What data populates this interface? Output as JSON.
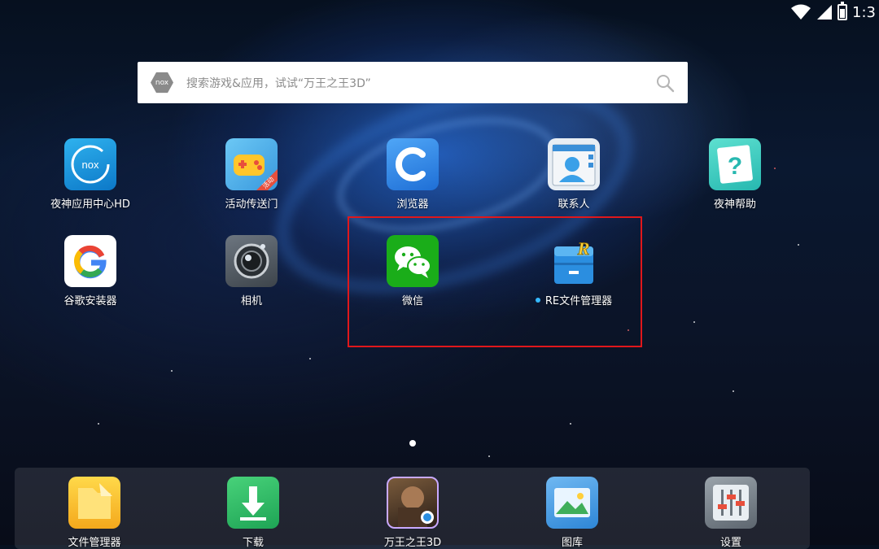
{
  "status_bar": {
    "time": "1:3",
    "icons": [
      "wifi-icon",
      "signal-icon",
      "battery-icon"
    ]
  },
  "search": {
    "placeholder": "搜索游戏&应用，试试“万王之王3D”",
    "logo_text": "nox"
  },
  "apps": [
    {
      "label": "夜神应用中心HD",
      "icon": "nox-app-center-icon"
    },
    {
      "label": "活动传送门",
      "icon": "event-portal-icon",
      "badge": "活动"
    },
    {
      "label": "浏览器",
      "icon": "browser-icon"
    },
    {
      "label": "联系人",
      "icon": "contacts-icon"
    },
    {
      "label": "夜神帮助",
      "icon": "nox-help-icon"
    },
    {
      "label": "谷歌安装器",
      "icon": "google-installer-icon"
    },
    {
      "label": "相机",
      "icon": "camera-icon"
    },
    {
      "label": "微信",
      "icon": "wechat-icon"
    },
    {
      "label": "RE文件管理器",
      "icon": "re-file-manager-icon",
      "new_dot": true
    }
  ],
  "dock": [
    {
      "label": "文件管理器",
      "icon": "file-manager-icon"
    },
    {
      "label": "下载",
      "icon": "download-icon"
    },
    {
      "label": "万王之王3D",
      "icon": "game-icon"
    },
    {
      "label": "图库",
      "icon": "gallery-icon"
    },
    {
      "label": "设置",
      "icon": "settings-icon"
    }
  ],
  "colors": {
    "highlight": "#e0171b",
    "new_dot": "#35b9ff"
  }
}
